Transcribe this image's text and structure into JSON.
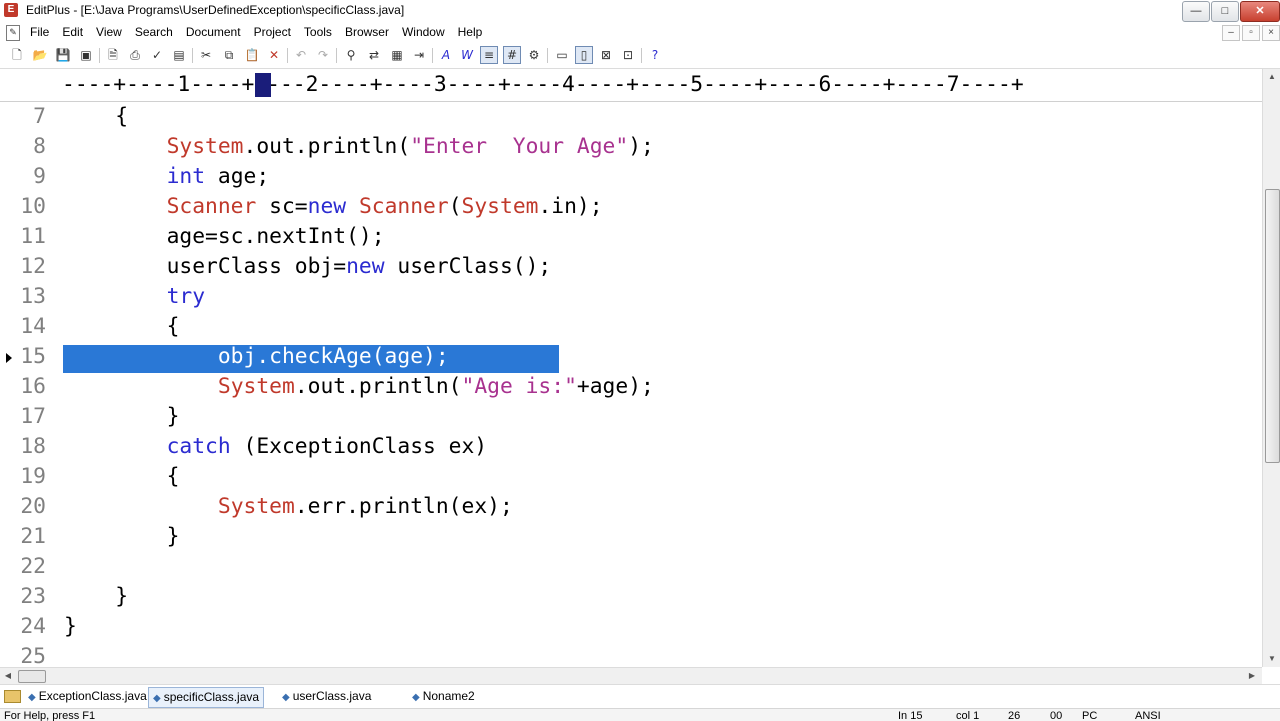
{
  "window": {
    "title": "EditPlus - [E:\\Java Programs\\UserDefinedException\\specificClass.java]",
    "app_icon": "editplus-icon",
    "controls": {
      "minimize": "—",
      "maximize": "□",
      "close": "✕"
    }
  },
  "menu": {
    "items": [
      "File",
      "Edit",
      "View",
      "Search",
      "Document",
      "Project",
      "Tools",
      "Browser",
      "Window",
      "Help"
    ],
    "mdi_controls": {
      "minimize": "–",
      "restore": "▫",
      "close": "×"
    }
  },
  "toolbar": {
    "icons": [
      "new-file-icon",
      "open-file-icon",
      "save-icon",
      "save-all-icon",
      "print-preview-icon",
      "print-icon",
      "spell-check-icon",
      "clipboard-icon",
      "cut-icon",
      "copy-icon",
      "paste-icon",
      "delete-icon",
      "undo-icon",
      "redo-icon",
      "find-icon",
      "replace-icon",
      "select-all-icon",
      "indent-icon",
      "font-icon",
      "word-wrap-icon",
      "ruler-icon",
      "line-number-icon",
      "settings-icon",
      "browser-icon",
      "toolbar-toggle-icon",
      "close-window-icon",
      "output-icon",
      "help-icon"
    ]
  },
  "ruler": {
    "text": "----+----1----+----2----+----3----+----4----+----5----+----6----+----7----+",
    "cursor_column": 13
  },
  "editor": {
    "lines": [
      {
        "num": "7",
        "tokens": [
          {
            "t": "    {",
            "c": "plain"
          }
        ]
      },
      {
        "num": "8",
        "tokens": [
          {
            "t": "        ",
            "c": "plain"
          },
          {
            "t": "System",
            "c": "cls"
          },
          {
            "t": ".out.println(",
            "c": "plain"
          },
          {
            "t": "\"Enter  Your Age\"",
            "c": "str"
          },
          {
            "t": ");",
            "c": "plain"
          }
        ]
      },
      {
        "num": "9",
        "tokens": [
          {
            "t": "        ",
            "c": "plain"
          },
          {
            "t": "int",
            "c": "kw"
          },
          {
            "t": " age;",
            "c": "plain"
          }
        ]
      },
      {
        "num": "10",
        "tokens": [
          {
            "t": "        ",
            "c": "plain"
          },
          {
            "t": "Scanner",
            "c": "cls"
          },
          {
            "t": " sc=",
            "c": "plain"
          },
          {
            "t": "new",
            "c": "kw"
          },
          {
            "t": " ",
            "c": "plain"
          },
          {
            "t": "Scanner",
            "c": "cls"
          },
          {
            "t": "(",
            "c": "plain"
          },
          {
            "t": "System",
            "c": "cls"
          },
          {
            "t": ".in);",
            "c": "plain"
          }
        ]
      },
      {
        "num": "11",
        "tokens": [
          {
            "t": "        age=sc.nextInt();",
            "c": "plain"
          }
        ]
      },
      {
        "num": "12",
        "tokens": [
          {
            "t": "        userClass obj=",
            "c": "plain"
          },
          {
            "t": "new",
            "c": "kw"
          },
          {
            "t": " userClass();",
            "c": "plain"
          }
        ]
      },
      {
        "num": "13",
        "tokens": [
          {
            "t": "        ",
            "c": "plain"
          },
          {
            "t": "try",
            "c": "kw"
          }
        ]
      },
      {
        "num": "14",
        "tokens": [
          {
            "t": "        {",
            "c": "plain"
          }
        ]
      },
      {
        "num": "15",
        "selected": true,
        "tokens": [
          {
            "t": "            obj.checkAge(age);",
            "c": "sel"
          }
        ]
      },
      {
        "num": "16",
        "tokens": [
          {
            "t": "            ",
            "c": "plain"
          },
          {
            "t": "System",
            "c": "cls"
          },
          {
            "t": ".out.println(",
            "c": "plain"
          },
          {
            "t": "\"Age is:\"",
            "c": "str"
          },
          {
            "t": "+age);",
            "c": "plain"
          }
        ]
      },
      {
        "num": "17",
        "tokens": [
          {
            "t": "        }",
            "c": "plain"
          }
        ]
      },
      {
        "num": "18",
        "tokens": [
          {
            "t": "        ",
            "c": "plain"
          },
          {
            "t": "catch",
            "c": "kw"
          },
          {
            "t": " (ExceptionClass ex)",
            "c": "plain"
          }
        ]
      },
      {
        "num": "19",
        "tokens": [
          {
            "t": "        {",
            "c": "plain"
          }
        ]
      },
      {
        "num": "20",
        "tokens": [
          {
            "t": "            ",
            "c": "plain"
          },
          {
            "t": "System",
            "c": "cls"
          },
          {
            "t": ".err.println(ex);",
            "c": "plain"
          }
        ]
      },
      {
        "num": "21",
        "tokens": [
          {
            "t": "        }",
            "c": "plain"
          }
        ]
      },
      {
        "num": "22",
        "tokens": []
      },
      {
        "num": "23",
        "tokens": [
          {
            "t": "    }",
            "c": "plain"
          }
        ]
      },
      {
        "num": "24",
        "tokens": [
          {
            "t": "}",
            "c": "plain"
          }
        ]
      },
      {
        "num": "25",
        "tokens": []
      }
    ]
  },
  "tabs": [
    {
      "label": "ExceptionClass.java",
      "active": false
    },
    {
      "label": "specificClass.java",
      "active": true
    },
    {
      "label": "userClass.java",
      "active": false
    },
    {
      "label": "Noname2",
      "active": false
    }
  ],
  "status": {
    "help": "For Help, press F1",
    "line": "In 15",
    "col": "col 1",
    "num1": "26",
    "num2": "00",
    "mode": "PC",
    "encoding": "ANSI"
  },
  "colors": {
    "keyword": "#2b2bd0",
    "class": "#c0392b",
    "string": "#a8328f",
    "selection": "#2a78d6"
  }
}
